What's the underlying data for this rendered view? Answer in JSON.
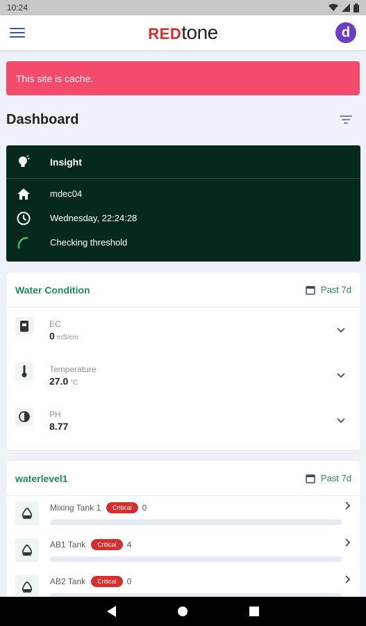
{
  "status_bar": {
    "time": "10:24"
  },
  "header": {
    "brand_red": "RED",
    "brand_tone": "tone",
    "avatar_letter": "d"
  },
  "alert": {
    "text": "This site is cache."
  },
  "dashboard": {
    "title": "Dashboard"
  },
  "insight": {
    "title": "Insight",
    "site": "mdec04",
    "datetime": "Wednesday, 22:24:28",
    "status": "Checking threshold"
  },
  "water_condition": {
    "title": "Water Condition",
    "period": "Past 7d",
    "metrics": [
      {
        "label": "EC",
        "value": "0",
        "unit": "mS/cm"
      },
      {
        "label": "Temperature",
        "value": "27.0",
        "unit": "°C"
      },
      {
        "label": "PH",
        "value": "8.77",
        "unit": ""
      }
    ]
  },
  "waterlevel": {
    "title": "waterlevel1",
    "period": "Past 7d",
    "tanks": [
      {
        "name": "Mixing Tank 1",
        "badge": "Critical",
        "count": "0",
        "level": 0
      },
      {
        "name": "AB1 Tank",
        "badge": "Critical",
        "count": "4",
        "level": 0
      },
      {
        "name": "AB2 Tank",
        "badge": "Critical",
        "count": "0",
        "level": 0
      }
    ]
  },
  "colors": {
    "accent_green": "#1f8a5b",
    "alert": "#f44a6b",
    "insight_bg": "#06291f",
    "critical": "#d62d2d",
    "brand_red": "#e02a2a"
  }
}
